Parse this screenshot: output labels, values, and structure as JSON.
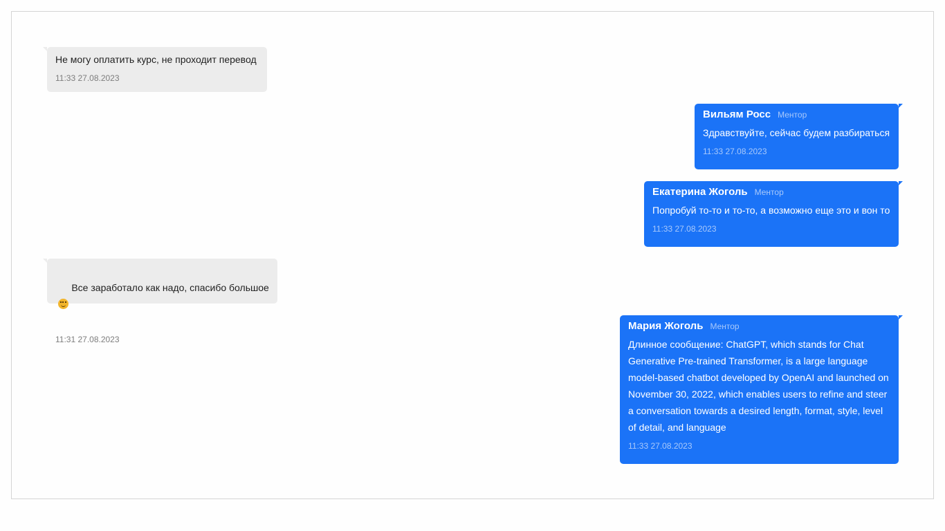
{
  "messages": [
    {
      "text": "Не могу оплатить курс, не проходит перевод",
      "time": "11:33 27.08.2023"
    },
    {
      "author": "Вильям Росс",
      "role": "Ментор",
      "text": "Здравствуйте, сейчас будем разбираться",
      "time": "11:33 27.08.2023"
    },
    {
      "author": "Екатерина Жоголь",
      "role": "Ментор",
      "text": "Попробуй то-то и то-то, а возможно еще это и вон то",
      "time": "11:33 27.08.2023"
    },
    {
      "text": "Все заработало как надо, спасибо большое",
      "emoji": "smiling-face-emoji",
      "time": "11:31 27.08.2023"
    },
    {
      "author": "Мария Жоголь",
      "role": "Ментор",
      "text": "Длинное сообщение: ChatGPT, which stands for Chat\nGenerative Pre-trained Transformer, is a large language\nmodel-based chatbot developed by OpenAI and launched on\nNovember 30, 2022, which enables users to refine and steer\na conversation towards a desired length, format, style, level\nof detail, and language",
      "time": "11:33 27.08.2023"
    }
  ],
  "colors": {
    "incoming": "#ececec",
    "outgoing": "#1b73f7",
    "meta_on_blue": "#a9c9fb"
  }
}
